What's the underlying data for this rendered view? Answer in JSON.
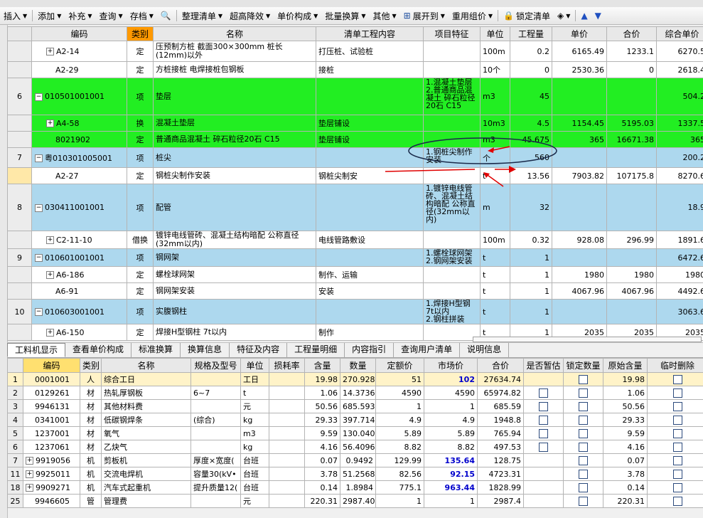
{
  "toolbar": {
    "items": [
      "插入",
      "添加",
      "补充",
      "查询",
      "存档",
      "整理清单",
      "超高降效",
      "单价构成",
      "批量换算",
      "其他",
      "展开到",
      "重用组价",
      "锁定清单"
    ]
  },
  "upper_table": {
    "headers": [
      "编码",
      "类别",
      "名称",
      "清单工程内容",
      "项目特征",
      "单位",
      "工程量",
      "单价",
      "合价",
      "综合单价"
    ],
    "rows": [
      {
        "num": "",
        "code": "A2-14",
        "cat": "定",
        "name": "压预制方桩 截面300×300mm 桩长(12mm)以外",
        "content": "打压桩、试验桩",
        "feature": "",
        "unit": "100m",
        "qty": "0.2",
        "price": "6165.49",
        "total": "1233.1",
        "comp": "6270.5"
      },
      {
        "num": "",
        "code": "A2-29",
        "cat": "定",
        "name": "方桩接桩 电焊接桩包钢板",
        "content": "接桩",
        "feature": "",
        "unit": "10个",
        "qty": "0",
        "price": "2530.36",
        "total": "0",
        "comp": "2618.4"
      },
      {
        "num": "6",
        "code": "010501001001",
        "cat": "项",
        "name": "垫层",
        "content": "",
        "feature": "1.混凝土垫层\n2.普通商品混凝土 碎石粒径20石 C15",
        "unit": "m3",
        "qty": "45",
        "price": "",
        "total": "",
        "comp": "504.2"
      },
      {
        "num": "",
        "code": "A4-58",
        "cat": "换",
        "name": "混凝土垫层",
        "content": "垫层铺设",
        "feature": "",
        "unit": "10m3",
        "qty": "4.5",
        "price": "1154.45",
        "total": "5195.03",
        "comp": "1337.5"
      },
      {
        "num": "",
        "code": "8021902",
        "cat": "定",
        "name": "普通商品混凝土 碎石粒径20石 C15",
        "content": "垫层铺设",
        "feature": "",
        "unit": "m3",
        "qty": "45.675",
        "price": "365",
        "total": "16671.38",
        "comp": "365"
      },
      {
        "num": "7",
        "code": "粤010301005001",
        "cat": "项",
        "name": "桩尖",
        "content": "",
        "feature": "1.钢桩尖制作安装",
        "unit": "个",
        "qty": "560",
        "price": "",
        "total": "",
        "comp": "200.2"
      },
      {
        "num": "",
        "code": "A2-27",
        "cat": "定",
        "name": "钢桩尖制作安装",
        "content": "钢桩尖制安",
        "feature": "",
        "unit": "t",
        "qty": "13.56",
        "price": "7903.82",
        "total": "107175.8",
        "comp": "8270.6"
      },
      {
        "num": "8",
        "code": "030411001001",
        "cat": "项",
        "name": "配管",
        "content": "",
        "feature": "1.镀锌电线管砖、混凝土结构暗配 公称直径(32mm以内)",
        "unit": "m",
        "qty": "32",
        "price": "",
        "total": "",
        "comp": "18.9"
      },
      {
        "num": "",
        "code": "C2-11-10",
        "cat": "借换",
        "name": "镀锌电线管砖、混凝土结构暗配 公称直径(32mm以内)",
        "content": "电线管路敷设",
        "feature": "",
        "unit": "100m",
        "qty": "0.32",
        "price": "928.08",
        "total": "296.99",
        "comp": "1891.6"
      },
      {
        "num": "9",
        "code": "010601001001",
        "cat": "项",
        "name": "钢网架",
        "content": "",
        "feature": "1.螺栓球网架\n2.钢网架安装",
        "unit": "t",
        "qty": "1",
        "price": "",
        "total": "",
        "comp": "6472.6"
      },
      {
        "num": "",
        "code": "A6-186",
        "cat": "定",
        "name": "螺栓球网架",
        "content": "制作、运输",
        "feature": "",
        "unit": "t",
        "qty": "1",
        "price": "1980",
        "total": "1980",
        "comp": "1980"
      },
      {
        "num": "",
        "code": "A6-91",
        "cat": "定",
        "name": "钢网架安装",
        "content": "安装",
        "feature": "",
        "unit": "t",
        "qty": "1",
        "price": "4067.96",
        "total": "4067.96",
        "comp": "4492.6"
      },
      {
        "num": "10",
        "code": "010603001001",
        "cat": "项",
        "name": "实腹钢柱",
        "content": "",
        "feature": "1.焊接H型钢 7t以内\n2.钢柱拼装",
        "unit": "t",
        "qty": "1",
        "price": "",
        "total": "",
        "comp": "3063.6"
      },
      {
        "num": "",
        "code": "A6-150",
        "cat": "定",
        "name": "焊接H型钢柱 7t以内",
        "content": "制作",
        "feature": "",
        "unit": "t",
        "qty": "1",
        "price": "2035",
        "total": "2035",
        "comp": "2035"
      }
    ]
  },
  "tabs": [
    "工料机显示",
    "查看单价构成",
    "标准换算",
    "换算信息",
    "特征及内容",
    "工程量明细",
    "内容指引",
    "查询用户清单",
    "说明信息"
  ],
  "lower_table": {
    "headers": [
      "编码",
      "类别",
      "名称",
      "规格及型号",
      "单位",
      "损耗率",
      "含量",
      "数量",
      "定额价",
      "市场价",
      "合价",
      "是否暂估",
      "锁定数量",
      "原始含量",
      "临时删除"
    ],
    "rows": [
      {
        "num": "1",
        "code": "0001001",
        "cat": "人",
        "name": "综合工日",
        "spec": "",
        "unit": "工日",
        "loss": "",
        "content": "19.98",
        "qty": "270.928",
        "quota": "51",
        "market": "102",
        "total": "27634.74",
        "orig": "19.98",
        "exp": false
      },
      {
        "num": "2",
        "code": "0129261",
        "cat": "材",
        "name": "热轧厚钢板",
        "spec": "6~7",
        "unit": "t",
        "loss": "",
        "content": "1.06",
        "qty": "14.3736",
        "quota": "4590",
        "market": "4590",
        "total": "65974.82",
        "orig": "1.06",
        "exp": false
      },
      {
        "num": "3",
        "code": "9946131",
        "cat": "材",
        "name": "其他材料费",
        "spec": "",
        "unit": "元",
        "loss": "",
        "content": "50.56",
        "qty": "685.593",
        "quota": "1",
        "market": "1",
        "total": "685.59",
        "orig": "50.56",
        "exp": false
      },
      {
        "num": "4",
        "code": "0341001",
        "cat": "材",
        "name": "低碳钢焊条",
        "spec": "(综合)",
        "unit": "kg",
        "loss": "",
        "content": "29.33",
        "qty": "397.714",
        "quota": "4.9",
        "market": "4.9",
        "total": "1948.8",
        "orig": "29.33",
        "exp": false
      },
      {
        "num": "5",
        "code": "1237001",
        "cat": "材",
        "name": "氧气",
        "spec": "",
        "unit": "m3",
        "loss": "",
        "content": "9.59",
        "qty": "130.040",
        "quota": "5.89",
        "market": "5.89",
        "total": "765.94",
        "orig": "9.59",
        "exp": false
      },
      {
        "num": "6",
        "code": "1237061",
        "cat": "材",
        "name": "乙炔气",
        "spec": "",
        "unit": "kg",
        "loss": "",
        "content": "4.16",
        "qty": "56.4096",
        "quota": "8.82",
        "market": "8.82",
        "total": "497.53",
        "orig": "4.16",
        "exp": false
      },
      {
        "num": "7",
        "code": "9919056",
        "cat": "机",
        "name": "剪板机",
        "spec": "厚度×宽度(",
        "unit": "台班",
        "loss": "",
        "content": "0.07",
        "qty": "0.9492",
        "quota": "129.99",
        "market": "135.64",
        "total": "128.75",
        "orig": "0.07",
        "exp": true
      },
      {
        "num": "11",
        "code": "9925011",
        "cat": "机",
        "name": "交流电焊机",
        "spec": "容量30(kV•",
        "unit": "台班",
        "loss": "",
        "content": "3.78",
        "qty": "51.2568",
        "quota": "82.56",
        "market": "92.15",
        "total": "4723.31",
        "orig": "3.78",
        "exp": true
      },
      {
        "num": "18",
        "code": "9909271",
        "cat": "机",
        "name": "汽车式起重机",
        "spec": "提升质量12(",
        "unit": "台班",
        "loss": "",
        "content": "0.14",
        "qty": "1.8984",
        "quota": "775.1",
        "market": "963.44",
        "total": "1828.99",
        "orig": "0.14",
        "exp": true
      },
      {
        "num": "25",
        "code": "9946605",
        "cat": "管",
        "name": "管理费",
        "spec": "",
        "unit": "元",
        "loss": "",
        "content": "220.31",
        "qty": "2987.40",
        "quota": "1",
        "market": "1",
        "total": "2987.4",
        "orig": "220.31",
        "exp": false
      }
    ]
  },
  "colors": {
    "green": "#22ee22",
    "blue": "#add8ee",
    "annotation": "#e00000",
    "oval": "#1a2a4a"
  }
}
